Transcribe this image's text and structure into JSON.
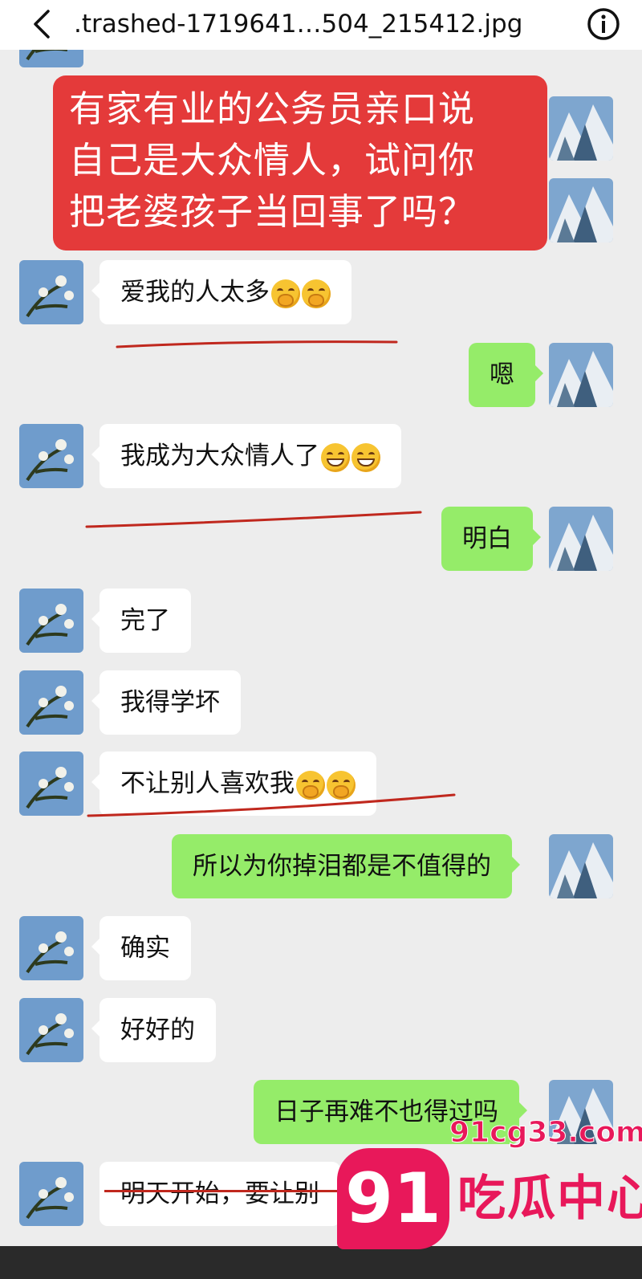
{
  "header": {
    "title": ".trashed-1719641…504_215412.jpg"
  },
  "overlay_caption": {
    "lines": [
      "有家有业的公务员亲口说",
      "自己是大众情人，试问你",
      "把老婆孩子当回事了吗？"
    ]
  },
  "messages": [
    {
      "side": "in",
      "text": "爱我的人太多",
      "emoji": "giggle",
      "emoji_count": 2
    },
    {
      "side": "out",
      "text": "嗯"
    },
    {
      "side": "in",
      "text": "我成为大众情人了",
      "emoji": "grin",
      "emoji_count": 2
    },
    {
      "side": "out",
      "text": "明白"
    },
    {
      "side": "in",
      "text": "完了"
    },
    {
      "side": "in",
      "text": "我得学坏"
    },
    {
      "side": "in",
      "text": "不让别人喜欢我",
      "emoji": "giggle",
      "emoji_count": 2
    },
    {
      "side": "out",
      "text": "所以为你掉泪都是不值得的"
    },
    {
      "side": "in",
      "text": "确实"
    },
    {
      "side": "in",
      "text": "好好的"
    },
    {
      "side": "out",
      "text": "日子再难不也得过吗"
    },
    {
      "side": "in",
      "text": "明天开始，要让别"
    }
  ],
  "watermark": {
    "site": "91cg33.com",
    "number": "91",
    "name": "吃瓜中心"
  },
  "colors": {
    "incoming_bubble": "#ffffff",
    "outgoing_bubble": "#95ec69",
    "caption_background": "#e43a3a",
    "underline": "#c0281e",
    "watermark": "#e8185a"
  }
}
